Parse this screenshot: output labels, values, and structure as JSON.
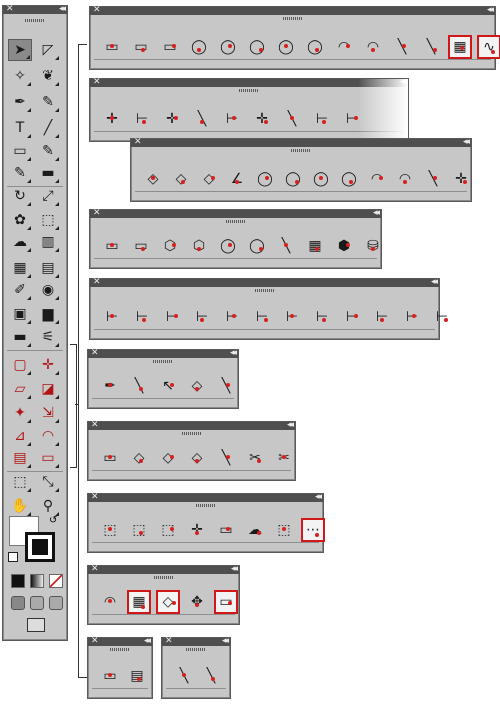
{
  "toolbox": {
    "close": "✕",
    "collapse": "◂◂"
  },
  "panels": [
    {
      "id": "p1",
      "close": "✕",
      "collapse": "◂◂",
      "tools": [
        "rectangle-icon",
        "rounded-rect-icon",
        "oval-rect-icon",
        "circle-icon",
        "circle-center-icon",
        "circle-dot-icon",
        "eye-ellipse-icon",
        "circle-three-point-icon",
        "arc-icon",
        "arc-center-icon",
        "line-icon",
        "tangent-line-icon",
        "grid-icon",
        "wave-icon"
      ],
      "highlighted": [
        12,
        13
      ]
    },
    {
      "id": "p2",
      "close": "✕",
      "collapse": "◂◂",
      "tools": [
        "crosshair-icon",
        "dimension-horizontal-icon",
        "dimension-center-icon",
        "dimension-baseline-icon",
        "dimension-vertical-icon",
        "dimension-vertical-center-icon",
        "dimension-vertical-baseline-icon",
        "dimension-angle-icon",
        "dimension-diagonal-icon"
      ],
      "highlighted": []
    },
    {
      "id": "p3",
      "close": "✕",
      "collapse": "◂◂",
      "tools": [
        "diagonal-n-icon",
        "diagonal-h-icon",
        "diagonal-v-icon",
        "angle-icon",
        "radius-arc-icon",
        "diameter-icon",
        "radius-icon",
        "radius-leader-icon",
        "arc-length-icon",
        "arc-tangent-icon",
        "leader-icon",
        "center-mark-icon"
      ],
      "highlighted": []
    },
    {
      "id": "p4",
      "close": "✕",
      "collapse": "◂◂",
      "tools": [
        "iso-rect-icon",
        "iso-rect-dot-icon",
        "iso-hexagon-icon",
        "iso-hex-dot-icon",
        "iso-ellipse-icon",
        "iso-ellipse-dot-icon",
        "iso-line-icon",
        "iso-grid-icon",
        "iso-cube-icon",
        "iso-cylinder-icon"
      ],
      "highlighted": []
    },
    {
      "id": "p5",
      "close": "✕",
      "collapse": "◂◂",
      "tools": [
        "iso-dim-1-icon",
        "iso-dim-2-icon",
        "iso-dim-3-icon",
        "iso-dim-4-icon",
        "iso-dim-5-icon",
        "iso-dim-6-icon",
        "iso-dim-7-icon",
        "iso-dim-8-icon",
        "iso-dim-9-icon",
        "iso-dim-10-icon",
        "iso-dim-11-icon",
        "iso-dim-12-icon"
      ],
      "highlighted": []
    },
    {
      "id": "p6",
      "close": "✕",
      "collapse": "◂◂",
      "tools": [
        "pen-plus-icon",
        "pen-line-icon",
        "select-point-icon",
        "smooth-corner-icon",
        "break-line-icon"
      ],
      "highlighted": []
    },
    {
      "id": "p7",
      "close": "✕",
      "collapse": "◂◂",
      "tools": [
        "direct-select-icon",
        "corner-round-icon",
        "corner-chamfer-icon",
        "corner-round-2-icon",
        "extend-line-icon",
        "trim-icon",
        "break-icon"
      ],
      "highlighted": []
    },
    {
      "id": "p8",
      "close": "✕",
      "collapse": "◂◂",
      "tools": [
        "label-a-icon",
        "label-b-icon",
        "label-c-icon",
        "label-cross-icon",
        "label-frame-icon",
        "cloud-icon",
        "corner-label-icon",
        "tag-icon"
      ],
      "highlighted": [
        7
      ]
    },
    {
      "id": "p9",
      "close": "✕",
      "collapse": "◂◂",
      "tools": [
        "arc-offset-icon",
        "dot-grid-icon",
        "dotted-path-icon",
        "move-icon",
        "text-frame-icon"
      ],
      "highlighted": [
        1,
        2,
        4
      ]
    },
    {
      "id": "p10",
      "close": "✕",
      "collapse": "◂◂",
      "tools": [
        "frame-icon",
        "table-icon"
      ],
      "highlighted": []
    },
    {
      "id": "p11",
      "close": "✕",
      "collapse": "◂◂",
      "tools": [
        "dash-line-icon",
        "dash-dot-line-icon"
      ],
      "highlighted": []
    }
  ],
  "colors": {
    "panel": "#c7c7c7",
    "titlebar": "#4f4f4f",
    "accent": "#d62020",
    "highlight": "#d01818"
  }
}
